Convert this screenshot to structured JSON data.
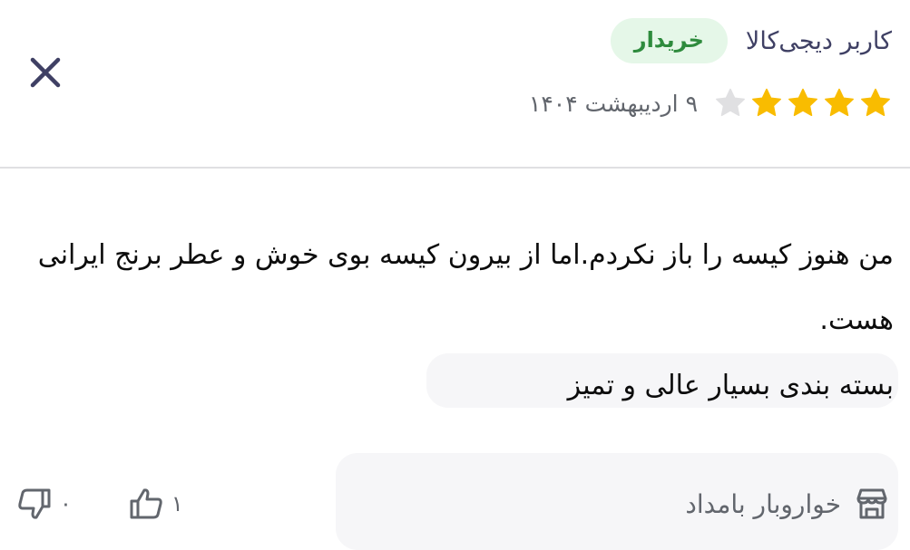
{
  "review": {
    "user_name": "کاربر دیجی‌کالا",
    "badge": "خریدار",
    "rating": 4,
    "max_rating": 5,
    "date": "۹ اردیبهشت ۱۴۰۴",
    "body": [
      "من هنوز کیسه را باز نکردم.اما از بیرون کیسه بوی خوش و عطر برنج ایرانی هست.",
      "بسته بندی بسیار عالی و تمیز"
    ],
    "seller": "خواروبار بامداد",
    "likes": "۱",
    "dislikes": "۰"
  },
  "icons": {
    "close": "close-icon",
    "star_filled": "star-filled-icon",
    "star_empty": "star-empty-icon",
    "seller": "store-icon",
    "like": "thumb-up-icon",
    "dislike": "thumb-down-icon"
  },
  "colors": {
    "star": "#f9bc00",
    "star_empty": "#e0e0e2",
    "badge_bg": "#e5f7e8",
    "badge_text": "#2e8b3d",
    "secondary_text": "#62666d",
    "divider": "#e0e0e2"
  }
}
